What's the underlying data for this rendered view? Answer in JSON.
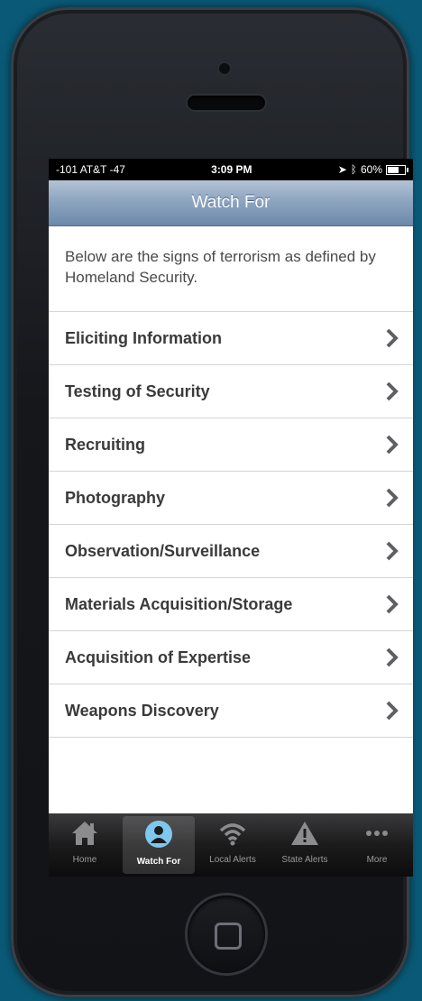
{
  "status": {
    "carrier": "-101 AT&T -47",
    "time": "3:09 PM",
    "battery": "60%"
  },
  "navbar": {
    "title": "Watch For"
  },
  "intro": "Below are the signs of terrorism as defined by Homeland Security.",
  "items": [
    {
      "label": "Eliciting Information"
    },
    {
      "label": "Testing of Security"
    },
    {
      "label": "Recruiting"
    },
    {
      "label": "Photography"
    },
    {
      "label": "Observation/Surveillance"
    },
    {
      "label": "Materials Acquisition/Storage"
    },
    {
      "label": "Acquisition of Expertise"
    },
    {
      "label": "Weapons Discovery"
    }
  ],
  "tabs": [
    {
      "label": "Home",
      "icon": "house-icon"
    },
    {
      "label": "Watch For",
      "icon": "person-icon",
      "active": true
    },
    {
      "label": "Local Alerts",
      "icon": "wifi-icon"
    },
    {
      "label": "State Alerts",
      "icon": "warning-icon"
    },
    {
      "label": "More",
      "icon": "more-icon"
    }
  ],
  "colors": {
    "background": "#0a5a77",
    "navbar": "#8ea5c0",
    "active_icon": "#7ec8f0"
  }
}
